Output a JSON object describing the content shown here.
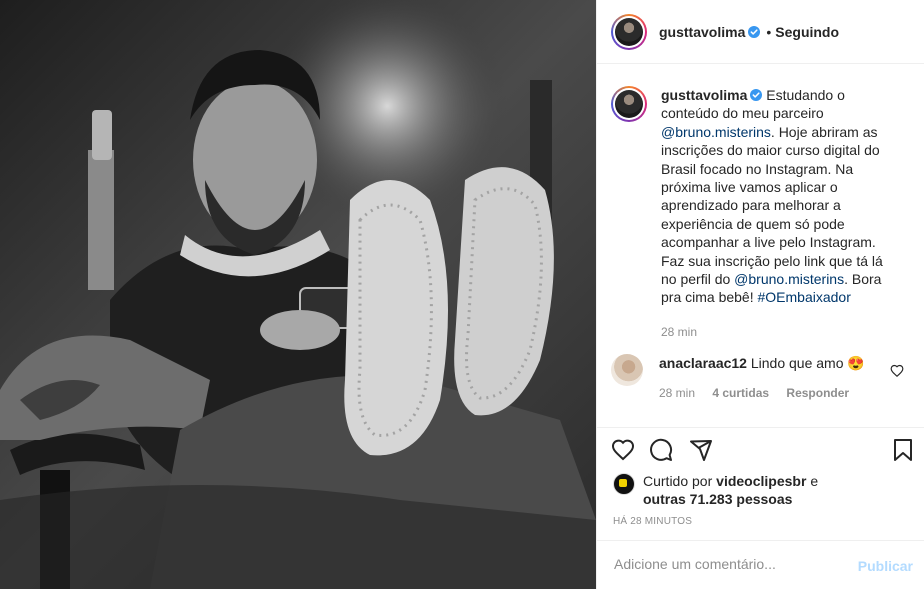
{
  "post": {
    "username": "gusttavolima",
    "follow_state": "Seguindo",
    "caption_text": "Estudando o conteúdo do meu parceiro",
    "mention1": "@bruno.misterins",
    "caption_mid": ". Hoje abriram as inscrições do maior curso digital do Brasil focado no Instagram. Na próxima live vamos aplicar o aprendizado para melhorar a experiência de quem só pode acompanhar a live pelo Instagram. Faz sua inscrição pelo link que tá lá no perfil do",
    "mention2": "@bruno.misterins",
    "caption_end": ". Bora pra cima bebê!",
    "hashtag": "#OEmbaixador",
    "caption_time": "28 min"
  },
  "comment": {
    "username": "anaclaraac12",
    "text": "Lindo que amo 😍",
    "time": "28 min",
    "likes": "4 curtidas",
    "reply": "Responder"
  },
  "likes": {
    "prefix": "Curtido por",
    "user": "videoclipesbr",
    "connector": "e",
    "others": "outras 71.283 pessoas"
  },
  "timestamp": "HÁ 28 MINUTOS",
  "add_comment": {
    "placeholder": "Adicione um comentário...",
    "publish": "Publicar"
  },
  "colors": {
    "link": "#00376b",
    "verified": "#3897f0",
    "publish_disabled": "#b3dbff"
  }
}
